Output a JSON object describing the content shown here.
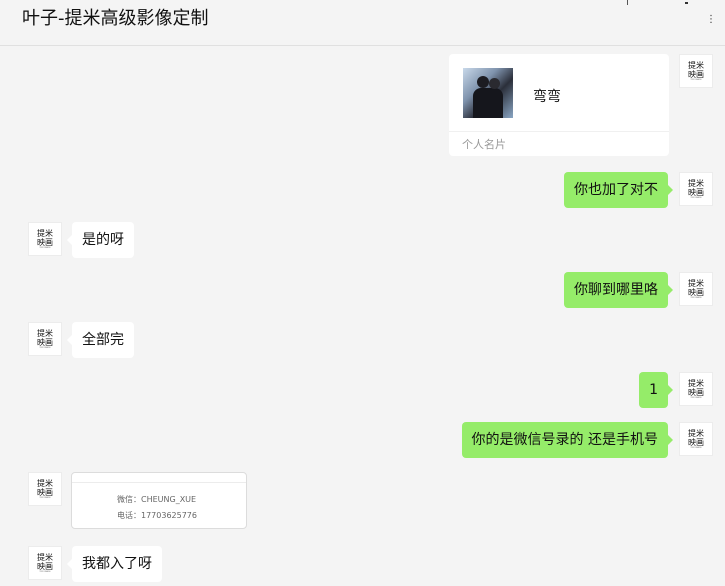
{
  "window": {
    "title": "叶子-提米高级影像定制"
  },
  "avatar_text": {
    "line1": "提米",
    "line2": "映画",
    "sub": "TIMI IMAGE"
  },
  "messages": [
    {
      "side": "right",
      "type": "contact_card",
      "name": "弯弯",
      "footer": "个人名片"
    },
    {
      "side": "right",
      "type": "text",
      "text": "你也加了对不"
    },
    {
      "side": "left",
      "type": "text",
      "text": "是的呀"
    },
    {
      "side": "right",
      "type": "text",
      "text": "你聊到哪里咯"
    },
    {
      "side": "left",
      "type": "text",
      "text": "全部完"
    },
    {
      "side": "right",
      "type": "text",
      "text": "1"
    },
    {
      "side": "right",
      "type": "text",
      "text": "你的是微信号录的 还是手机号"
    },
    {
      "side": "left",
      "type": "image",
      "line1": "微信：CHEUNG_XUE",
      "line2": "电话：17703625776"
    },
    {
      "side": "left",
      "type": "text",
      "text": "我都入了呀"
    }
  ],
  "colors": {
    "background": "#f4f4f4",
    "bubble_self": "#95ec69",
    "bubble_other": "#ffffff"
  }
}
